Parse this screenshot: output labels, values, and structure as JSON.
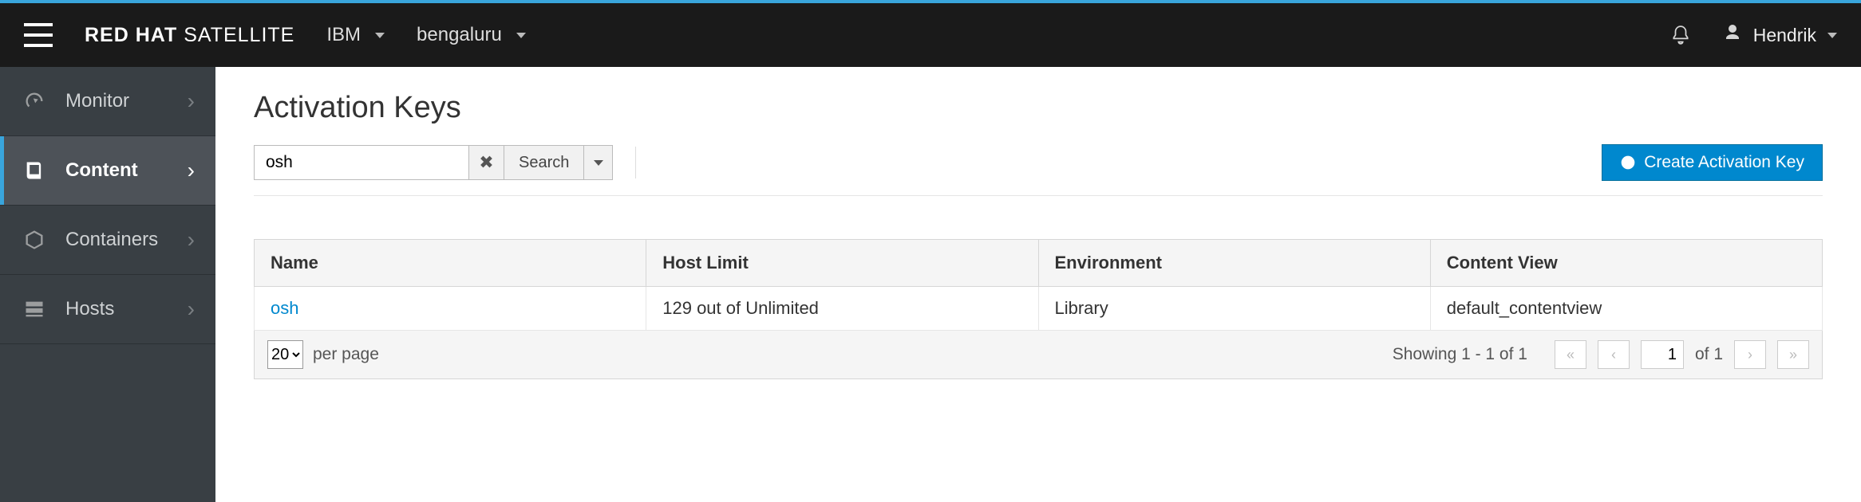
{
  "brand": {
    "bold": "RED HAT",
    "light": " SATELLITE"
  },
  "context": {
    "org": "IBM",
    "location": "bengaluru"
  },
  "user": {
    "name": "Hendrik"
  },
  "sidebar": {
    "items": [
      {
        "label": "Monitor"
      },
      {
        "label": "Content"
      },
      {
        "label": "Containers"
      },
      {
        "label": "Hosts"
      }
    ]
  },
  "page": {
    "title": "Activation Keys"
  },
  "search": {
    "value": "osh",
    "button": "Search"
  },
  "actions": {
    "create": "Create Activation Key"
  },
  "table": {
    "headers": {
      "name": "Name",
      "host_limit": "Host Limit",
      "environment": "Environment",
      "content_view": "Content View"
    },
    "rows": [
      {
        "name": "osh",
        "host_limit": "129 out of Unlimited",
        "environment": "Library",
        "content_view": "default_contentview"
      }
    ]
  },
  "pagination": {
    "per_page_value": "20",
    "per_page_label": "per page",
    "showing": "Showing 1 - 1 of 1",
    "page": "1",
    "of_label": "of 1"
  }
}
